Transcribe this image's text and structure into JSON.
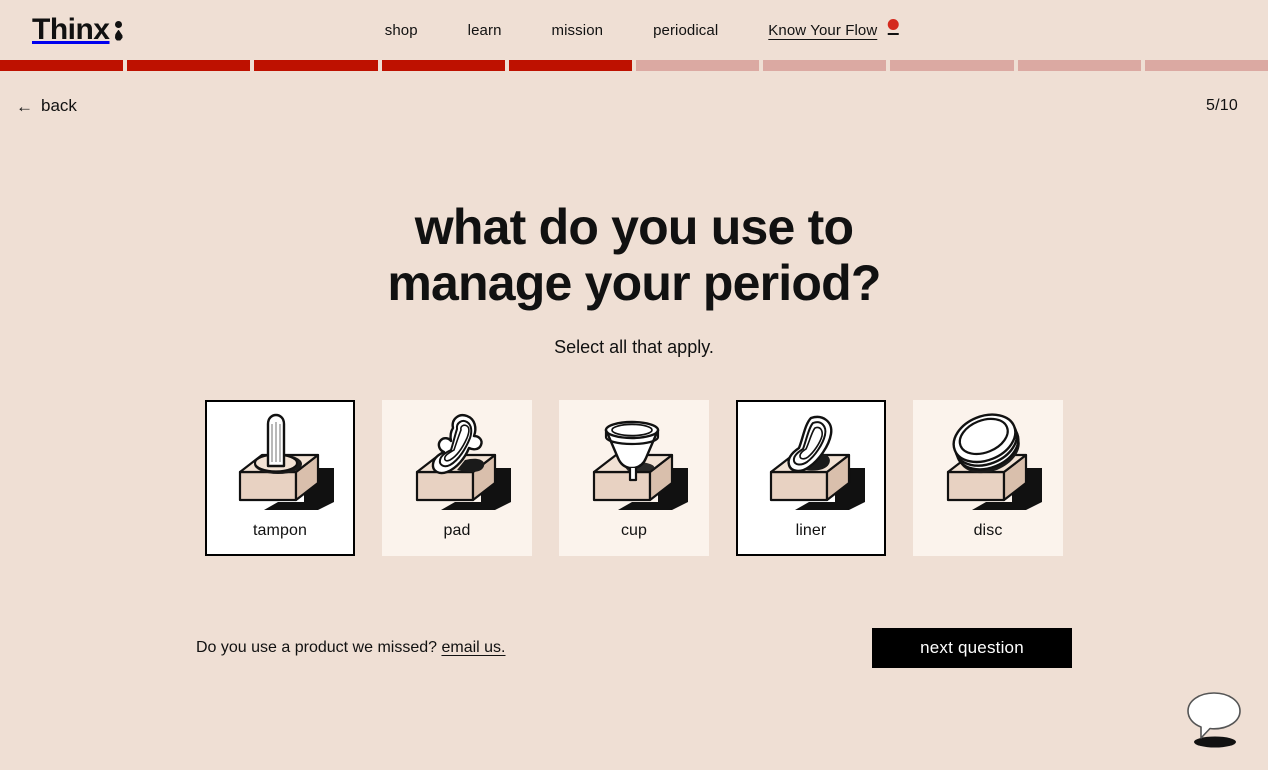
{
  "brand": {
    "name": "Thinx",
    "logo_icon": "thinx-drop-logo"
  },
  "nav": {
    "items": [
      {
        "label": "shop",
        "active": false
      },
      {
        "label": "learn",
        "active": false
      },
      {
        "label": "mission",
        "active": false
      },
      {
        "label": "periodical",
        "active": false
      },
      {
        "label": "Know Your Flow",
        "active": true
      }
    ],
    "flag_icon": "red-dot-indicator-icon"
  },
  "progress": {
    "total": 10,
    "completed": 5,
    "filled_color": "#BE1100",
    "empty_color": "#DBA9A2"
  },
  "quiz_bar": {
    "back_label": "back",
    "back_arrow": "←",
    "step_counter": "5/10"
  },
  "quiz": {
    "question": "what do you use to manage your period?",
    "subtitle": "Select all that apply.",
    "options": [
      {
        "label": "tampon",
        "selected": true,
        "art": "tampon-on-pedestal-icon"
      },
      {
        "label": "pad",
        "selected": false,
        "art": "pad-on-pedestal-icon"
      },
      {
        "label": "cup",
        "selected": false,
        "art": "menstrual-cup-on-pedestal-icon"
      },
      {
        "label": "liner",
        "selected": true,
        "art": "liner-on-pedestal-icon"
      },
      {
        "label": "disc",
        "selected": false,
        "art": "disc-on-pedestal-icon"
      }
    ]
  },
  "footer": {
    "missed_prompt": "Do you use a product we missed?",
    "email_link": "email us.",
    "next_button": "next question"
  },
  "chat": {
    "icon": "speech-bubble-chat-icon"
  },
  "colors": {
    "page_background": "#EFDFD4",
    "card_background": "#FBF3EC",
    "card_selected_background": "#FFFFFF",
    "accent_red": "#BE1100",
    "nav_dot_red": "#D42A1E",
    "text": "#111111",
    "button_background": "#000000"
  }
}
